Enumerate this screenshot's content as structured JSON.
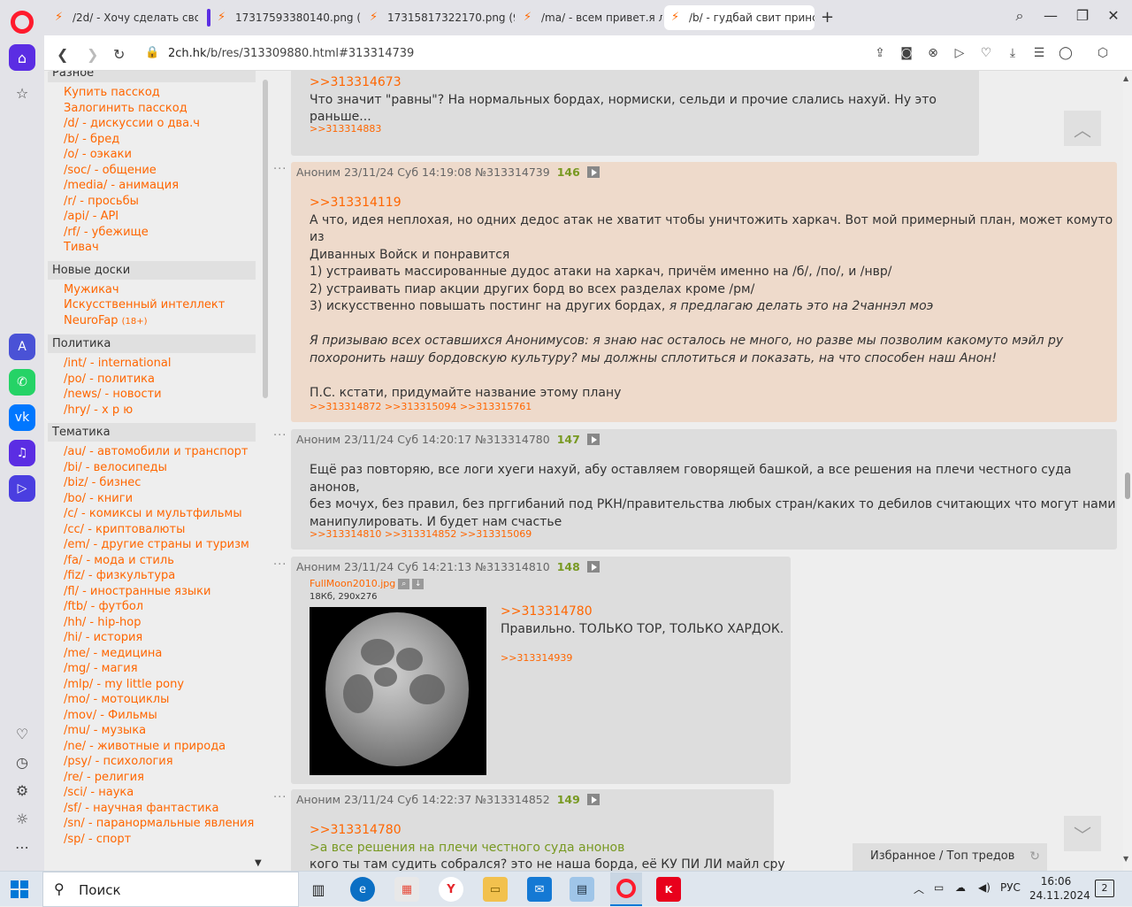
{
  "browser": {
    "tabs": [
      {
        "title": "/2d/ - Хочу сделать свою",
        "active": false
      },
      {
        "title": "17317593380140.png (878",
        "active": false
      },
      {
        "title": "17315817322170.png (917",
        "active": false
      },
      {
        "title": "/ma/ - всем привет.я люб",
        "active": false
      },
      {
        "title": "/b/ - гудбай свит принс д",
        "active": true
      }
    ],
    "new_tab": "+",
    "url_host": "2ch.hk",
    "url_path": "/b/res/313309880.html#313314739"
  },
  "sidebar": {
    "sections": [
      {
        "title": "Разное",
        "items": [
          {
            "code": "",
            "name": "Купить пасскод"
          },
          {
            "code": "",
            "name": "Залогинить пасскод"
          },
          {
            "code": "/d/",
            "name": "дискуссии о два.ч"
          },
          {
            "code": "/b/",
            "name": "бред"
          },
          {
            "code": "/o/",
            "name": "оэкаки"
          },
          {
            "code": "/soc/",
            "name": "общение"
          },
          {
            "code": "/media/",
            "name": "анимация"
          },
          {
            "code": "/r/",
            "name": "просьбы"
          },
          {
            "code": "/api/",
            "name": "API"
          },
          {
            "code": "/rf/",
            "name": "убежище"
          },
          {
            "code": "",
            "name": "Тивач"
          }
        ]
      },
      {
        "title": "Новые доски",
        "items": [
          {
            "code": "",
            "name": "Мужикач"
          },
          {
            "code": "",
            "name": "Искусственный интеллект"
          },
          {
            "code": "",
            "name": "NeuroFap",
            "tag": "(18+)"
          }
        ]
      },
      {
        "title": "Политика",
        "items": [
          {
            "code": "/int/",
            "name": "international"
          },
          {
            "code": "/po/",
            "name": "политика"
          },
          {
            "code": "/news/",
            "name": "новости"
          },
          {
            "code": "/hry/",
            "name": "х р ю"
          }
        ]
      },
      {
        "title": "Тематика",
        "items": [
          {
            "code": "/au/",
            "name": "автомобили и транспорт"
          },
          {
            "code": "/bi/",
            "name": "велосипеды"
          },
          {
            "code": "/biz/",
            "name": "бизнес"
          },
          {
            "code": "/bo/",
            "name": "книги"
          },
          {
            "code": "/c/",
            "name": "комиксы и мультфильмы"
          },
          {
            "code": "/cc/",
            "name": "криптовалюты"
          },
          {
            "code": "/em/",
            "name": "другие страны и туризм"
          },
          {
            "code": "/fa/",
            "name": "мода и стиль"
          },
          {
            "code": "/fiz/",
            "name": "физкультура"
          },
          {
            "code": "/fl/",
            "name": "иностранные языки"
          },
          {
            "code": "/ftb/",
            "name": "футбол"
          },
          {
            "code": "/hh/",
            "name": "hip-hop"
          },
          {
            "code": "/hi/",
            "name": "история"
          },
          {
            "code": "/me/",
            "name": "медицина"
          },
          {
            "code": "/mg/",
            "name": "магия"
          },
          {
            "code": "/mlp/",
            "name": "my little pony"
          },
          {
            "code": "/mo/",
            "name": "мотоциклы"
          },
          {
            "code": "/mov/",
            "name": "Фильмы"
          },
          {
            "code": "/mu/",
            "name": "музыка"
          },
          {
            "code": "/ne/",
            "name": "животные и природа"
          },
          {
            "code": "/psy/",
            "name": "психология"
          },
          {
            "code": "/re/",
            "name": "религия"
          },
          {
            "code": "/sci/",
            "name": "наука"
          },
          {
            "code": "/sf/",
            "name": "научная фантастика"
          },
          {
            "code": "/sn/",
            "name": "паранормальные явления"
          },
          {
            "code": "/sp/",
            "name": "спорт"
          }
        ]
      }
    ]
  },
  "posts": [
    {
      "id": "p0",
      "partial": true,
      "reply_to": ">>313314673",
      "text": "Что значит \"равны\"? На нормальных бордах, нормиски, сельди и прочие слались нахуй. Ну это раньше...",
      "replies": ">>313314883"
    },
    {
      "id": "p1",
      "author": "Аноним",
      "date": "23/11/24 Суб 14:19:08",
      "no": "№313314739",
      "idx": "146",
      "reply_to": ">>313314119",
      "lines": [
        "А что, идея неплохая, но одних дедос атак не хватит чтобы уничтожить харкач. Вот мой примерный план, может комуто из",
        "Диванных Войск и понравится",
        "1) устраивать массированные дудос атаки на харкач, причём именно на /б/, /по/, и /нвр/",
        "2) устраивать пиар акции других борд во всех разделах кроме /рм/",
        "3) искусственно повышать постинг на других бордах,"
      ],
      "line3_italic": " я предлагаю делать это на 2чаннэл моэ",
      "italic_lines": [
        "Я призываю всех оставшихся Анонимусов: я знаю нас осталось не много, но разве мы позволим какомуто мэйл ру",
        "похоронить нашу бордовскую культуру? мы должны сплотиться и показать, на что способен наш Анон!"
      ],
      "ps": "П.С. кстати, придумайте название этому плану",
      "replies": ">>313314872 >>313315094 >>313315761"
    },
    {
      "id": "p2",
      "author": "Аноним",
      "date": "23/11/24 Суб 14:20:17",
      "no": "№313314780",
      "idx": "147",
      "lines": [
        "Ещё раз повторяю, все логи хуеги нахуй, абу оставляем говорящей башкой, а все решения на плечи честного суда анонов,",
        "без мочух, без правил, без прггибаний под РКН/правительства любых стран/каких то дебилов считающих что могут нами",
        "манипулировать. И будет нам счастье"
      ],
      "replies": ">>313314810 >>313314852 >>313315069"
    },
    {
      "id": "p3",
      "author": "Аноним",
      "date": "23/11/24 Суб 14:21:13",
      "no": "№313314810",
      "idx": "148",
      "file_name": "FullMoon2010.jpg",
      "file_meta": "18Кб, 290x276",
      "reply_to": ">>313314780",
      "text": "Правильно. ТОЛЬКО ТОР, ТОЛЬКО ХАРДОК.",
      "replies": ">>313314939"
    },
    {
      "id": "p4",
      "author": "Аноним",
      "date": "23/11/24 Суб 14:22:37",
      "no": "№313314852",
      "idx": "149",
      "reply_to": ">>313314780",
      "quote": ">а все решения на плечи честного суда анонов",
      "text": "кого ты там судить собрался? это не наша борда, её КУ ПИ ЛИ майл сру"
    }
  ],
  "post_dots": "···",
  "favorites_bar": {
    "label": "Избранное / Топ тредов"
  },
  "taskbar": {
    "search_label": "Поиск",
    "lang": "РУС",
    "time": "16:06",
    "date": "24.11.2024",
    "notifications": "2"
  },
  "colors": {
    "accent": "#ff6600",
    "highlight_post": "#eedacb",
    "post_bg": "#dddddd",
    "post_index": "#789922"
  }
}
